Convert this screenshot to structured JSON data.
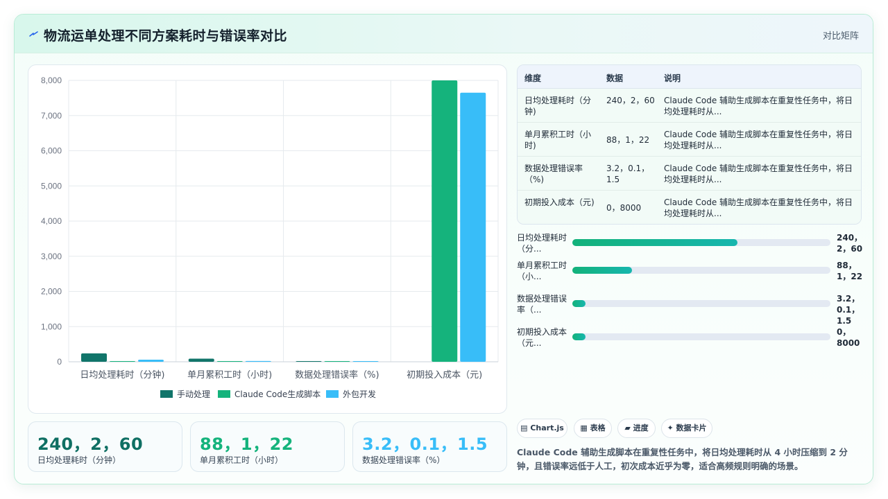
{
  "header": {
    "title": "物流运单处理不同方案耗时与错误率对比",
    "tag": "对比矩阵",
    "logo_icon": "lightning-icon"
  },
  "colors": {
    "manual": "#11756a",
    "claude": "#15b37c",
    "outsource": "#38bdf8"
  },
  "chart_data": {
    "type": "bar",
    "categories": [
      "日均处理耗时（分钟)",
      "单月累积工时（小时)",
      "数据处理错误率（%)",
      "初期投入成本（元)"
    ],
    "series": [
      {
        "name": "手动处理",
        "values": [
          240,
          88,
          3.2,
          0
        ]
      },
      {
        "name": "Claude Code生成脚本",
        "values": [
          2,
          1,
          0.1,
          8000
        ]
      },
      {
        "name": "外包开发",
        "values": [
          60,
          22,
          1.5,
          7650
        ]
      }
    ],
    "y_ticks": [
      "0",
      "1,000",
      "2,000",
      "3,000",
      "4,000",
      "5,000",
      "6,000",
      "7,000",
      "8,000"
    ],
    "ylim": [
      0,
      8000
    ],
    "grid": true,
    "legend": "bottom"
  },
  "kpis": [
    {
      "value": "240，2，60",
      "label": "日均处理耗时（分钟）",
      "color": "#0f6f63"
    },
    {
      "value": "88，1，22",
      "label": "单月累积工时（小时）",
      "color": "#15b37c"
    },
    {
      "value": "3.2，0.1，1.5",
      "label": "数据处理错误率（%）",
      "color": "#38bdf8"
    }
  ],
  "table": {
    "headers": [
      "维度",
      "数据",
      "说明"
    ],
    "rows": [
      {
        "dim": "日均处理耗时（分钟)",
        "data": "240，2，60",
        "desc": "Claude Code 辅助生成脚本在重复性任务中，将日均处理耗时从..."
      },
      {
        "dim": "单月累积工时（小时)",
        "data": "88，1，22",
        "desc": "Claude Code 辅助生成脚本在重复性任务中，将日均处理耗时从..."
      },
      {
        "dim": "数据处理错误率（%)",
        "data": "3.2，0.1，1.5",
        "desc": "Claude Code 辅助生成脚本在重复性任务中，将日均处理耗时从..."
      },
      {
        "dim": "初期投入成本（元)",
        "data": "0，8000",
        "desc": "Claude Code 辅助生成脚本在重复性任务中，将日均处理耗时从..."
      }
    ]
  },
  "progress": [
    {
      "label": "日均处理耗时（分...",
      "value": "240，2，60",
      "fraction": 0.64
    },
    {
      "label": "单月累积工时（小...",
      "value": "88，1，22",
      "fraction": 0.23
    },
    {
      "label": "数据处理错误率（...",
      "value": "3.2，0.1，1.5",
      "fraction": 0.05
    },
    {
      "label": "初期投入成本（元...",
      "value": "0，8000",
      "fraction": 0.05
    }
  ],
  "chips": [
    {
      "label": "▤ Chart.js"
    },
    {
      "label": "▦ 表格"
    },
    {
      "label": "▰ 进度"
    },
    {
      "label": "✦ 数据卡片"
    }
  ],
  "summary": "Claude Code 辅助生成脚本在重复性任务中，将日均处理耗时从 4 小时压缩到 2 分钟，且错误率远低于人工，初次成本近乎为零，适合高频规则明确的场景。"
}
